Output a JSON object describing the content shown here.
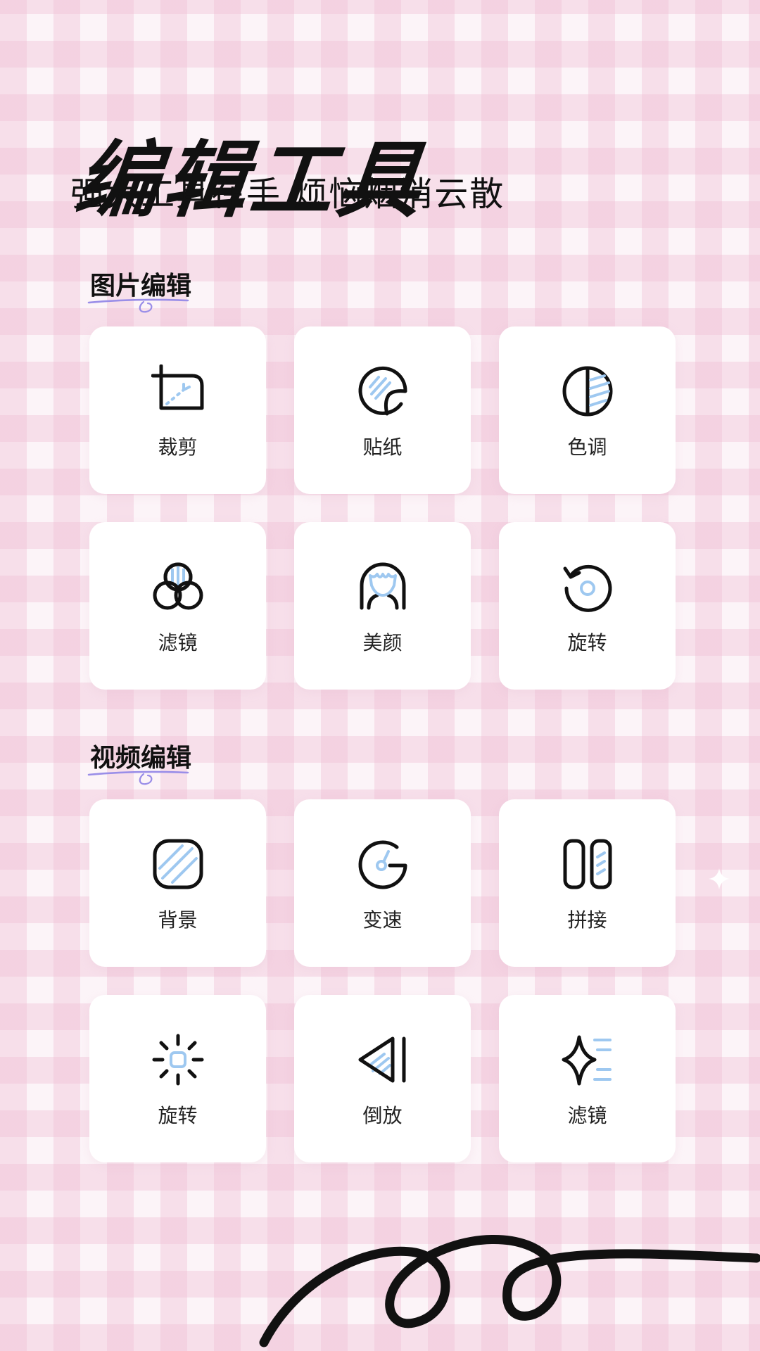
{
  "header": {
    "title": "编辑工具",
    "subtitle": "强大工具在手 烦恼烟消云散"
  },
  "sections": [
    {
      "title": "图片编辑",
      "tools": [
        {
          "label": "裁剪",
          "icon": "crop-icon"
        },
        {
          "label": "贴纸",
          "icon": "sticker-icon"
        },
        {
          "label": "色调",
          "icon": "tone-icon"
        },
        {
          "label": "滤镜",
          "icon": "filter-icon"
        },
        {
          "label": "美颜",
          "icon": "beauty-icon"
        },
        {
          "label": "旋转",
          "icon": "rotate-icon"
        }
      ]
    },
    {
      "title": "视频编辑",
      "tools": [
        {
          "label": "背景",
          "icon": "background-icon"
        },
        {
          "label": "变速",
          "icon": "speed-icon"
        },
        {
          "label": "拼接",
          "icon": "splice-icon"
        },
        {
          "label": "旋转",
          "icon": "brightness-icon"
        },
        {
          "label": "倒放",
          "icon": "reverse-icon"
        },
        {
          "label": "滤镜",
          "icon": "sparkle-filter-icon"
        }
      ]
    }
  ],
  "colors": {
    "accent": "#9ec8f0",
    "stroke": "#111111",
    "underline": "#9a8ee8",
    "check": "#f0bcd4"
  }
}
